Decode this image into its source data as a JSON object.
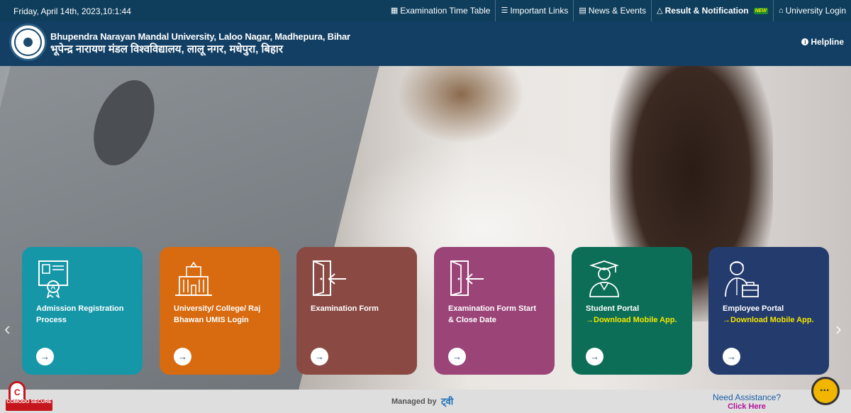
{
  "topbar": {
    "date": "Friday, April 14th, 2023,10:1:44",
    "links": [
      {
        "label": "Examination Time Table",
        "icon": "calendar-icon"
      },
      {
        "label": "Important Links",
        "icon": "list-icon"
      },
      {
        "label": "News & Events",
        "icon": "newspaper-icon"
      },
      {
        "label": "Result & Notification",
        "icon": "bell-icon",
        "badge": "NEW"
      },
      {
        "label": "University Login",
        "icon": "bank-icon"
      }
    ]
  },
  "header": {
    "name_en": "Bhupendra Narayan Mandal University, Laloo Nagar, Madhepura, Bihar",
    "name_hi": "भूपेन्द्र नारायण मंडल विश्वविद्यालय, लालू नगर, मधेपुरा, बिहार",
    "helpline": "Helpline"
  },
  "cards": [
    {
      "title": "Admission Registration Process",
      "sub": "",
      "color": "#1597a8",
      "icon": "certificate-icon"
    },
    {
      "title": "University/ College/ Raj Bhawan UMIS Login",
      "sub": "",
      "color": "#d86a0f",
      "icon": "building-icon"
    },
    {
      "title": "Examination Form",
      "sub": "",
      "color": "#8a4a43",
      "icon": "login-door-icon"
    },
    {
      "title": "Examination Form Start & Close Date",
      "sub": "",
      "color": "#9a4478",
      "icon": "login-door-icon"
    },
    {
      "title": "Student Portal",
      "sub": "→Download Mobile App.",
      "color": "#0d6e57",
      "icon": "graduate-icon"
    },
    {
      "title": "Employee Portal",
      "sub": "→Download Mobile App.",
      "color": "#243b6d",
      "icon": "employee-icon"
    }
  ],
  "card_button": "→",
  "footer": {
    "comodo": "COMODO SECURE",
    "managed_by": "Managed by",
    "managed_logo": "ट्वी",
    "assistance": "Need Assistance?",
    "click_here": "Click Here"
  }
}
